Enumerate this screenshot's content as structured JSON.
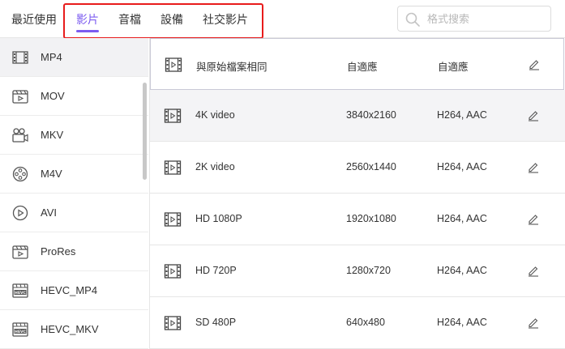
{
  "tabs": [
    {
      "label": "最近使用",
      "active": false
    },
    {
      "label": "影片",
      "active": true
    },
    {
      "label": "音檔",
      "active": false
    },
    {
      "label": "設備",
      "active": false
    },
    {
      "label": "社交影片",
      "active": false
    }
  ],
  "search": {
    "placeholder": "格式搜索",
    "icon": "search-icon"
  },
  "accent_color": "#7c5cf0",
  "highlight_color": "#e81c1c",
  "sidebar": {
    "items": [
      {
        "label": "MP4",
        "icon": "film-icon",
        "selected": true
      },
      {
        "label": "MOV",
        "icon": "clapper-icon"
      },
      {
        "label": "MKV",
        "icon": "camera-icon"
      },
      {
        "label": "M4V",
        "icon": "reel-icon"
      },
      {
        "label": "AVI",
        "icon": "play-circle-icon"
      },
      {
        "label": "ProRes",
        "icon": "clapper-icon"
      },
      {
        "label": "HEVC_MP4",
        "icon": "hevc-icon"
      },
      {
        "label": "HEVC_MKV",
        "icon": "hevc-icon"
      }
    ]
  },
  "presets": [
    {
      "name": "與原始檔案相同",
      "resolution": "自適應",
      "codec": "自適應"
    },
    {
      "name": "4K video",
      "resolution": "3840x2160",
      "codec": "H264, AAC"
    },
    {
      "name": "2K video",
      "resolution": "2560x1440",
      "codec": "H264, AAC"
    },
    {
      "name": "HD 1080P",
      "resolution": "1920x1080",
      "codec": "H264, AAC"
    },
    {
      "name": "HD 720P",
      "resolution": "1280x720",
      "codec": "H264, AAC"
    },
    {
      "name": "SD 480P",
      "resolution": "640x480",
      "codec": "H264, AAC"
    }
  ]
}
